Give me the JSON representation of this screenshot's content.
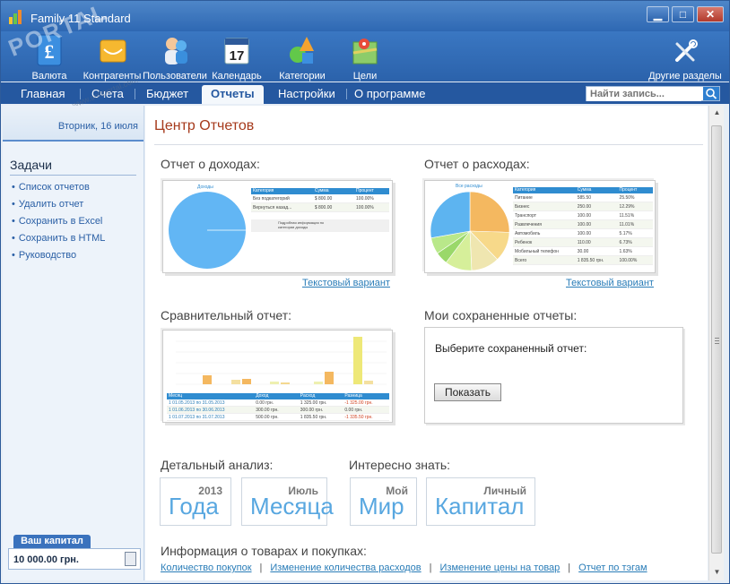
{
  "window": {
    "title": "Family 11 Standard",
    "minimize": "▁",
    "maximize": "□",
    "close": "✕"
  },
  "toolbar": {
    "items": [
      {
        "label": "Валюта",
        "icon": "currency-icon"
      },
      {
        "label": "Контрагенты",
        "icon": "contacts-icon"
      },
      {
        "label": "Пользователи",
        "icon": "users-icon"
      },
      {
        "label": "Календарь",
        "icon": "calendar-icon",
        "badge": "17"
      },
      {
        "label": "Категории",
        "icon": "categories-icon"
      },
      {
        "label": "Цели",
        "icon": "goals-icon"
      },
      {
        "label": "Другие разделы",
        "icon": "tools-icon"
      }
    ]
  },
  "watermark": {
    "text": "PORTAL",
    "url": "www.softportal.com"
  },
  "nav": {
    "tabs": [
      "Главная",
      "Счета",
      "Бюджет",
      "Отчеты",
      "Настройки",
      "О программе"
    ],
    "active": "Отчеты",
    "search_placeholder": "Найти запись..."
  },
  "sidebar": {
    "date": "Вторник, 16 июля",
    "tasks_title": "Задачи",
    "tasks": [
      "Список отчетов",
      "Удалить отчет",
      "Сохранить в Excel",
      "Сохранить в HTML",
      "Руководство"
    ],
    "capital_label": "Ваш капитал",
    "capital_value": "10 000.00 грн."
  },
  "main": {
    "title": "Центр Отчетов",
    "income": {
      "title": "Отчет о доходах:",
      "link": "Текстовый вариант",
      "pie_label": "Доходы",
      "table_headers": [
        "Категория",
        "Сумма",
        "Процент"
      ],
      "rows": [
        [
          "Без подкатегорий",
          "$ 800.00",
          "100.00%"
        ],
        [
          "Вернуться назад...",
          "$ 800.00",
          "100.00%"
        ]
      ],
      "note": "Подробная информация по категории доходы"
    },
    "expense": {
      "title": "Отчет о расходах:",
      "link": "Текстовый вариант",
      "pie_label": "Все расходы",
      "table_headers": [
        "Категория",
        "Сумма",
        "Процент"
      ],
      "rows": [
        [
          "Питание",
          "585.50",
          "25.50%"
        ],
        [
          "Бизнес",
          "250.00",
          "12.29%"
        ],
        [
          "Транспорт",
          "100.00",
          "11.51%"
        ],
        [
          "Развлечения",
          "100.00",
          "11.01%"
        ],
        [
          "Автомобиль",
          "100.00",
          "5.17%"
        ],
        [
          "Ребенок",
          "110.00",
          "6.73%"
        ],
        [
          "Мобильный телефон",
          "30.00",
          "1.63%"
        ],
        [
          "Всего",
          "1 835.50 грн.",
          "100.00%"
        ]
      ],
      "slices": [
        {
          "value": 25.5,
          "color": "#f4b860"
        },
        {
          "value": 12.29,
          "color": "#f7d98a"
        },
        {
          "value": 11.51,
          "color": "#efe6b0"
        },
        {
          "value": 11.01,
          "color": "#d6ef9a"
        },
        {
          "value": 5.17,
          "color": "#9ad86a"
        },
        {
          "value": 6.73,
          "color": "#b9e88a"
        },
        {
          "value": 27.79,
          "color": "#5db4f0"
        }
      ]
    },
    "compare": {
      "title": "Сравнительный отчет:",
      "headers": [
        "Месяц",
        "Доход",
        "Расход",
        "Разница"
      ],
      "rows": [
        [
          "1 01.05.2013 по 31.05.2013",
          "0.00 грн.",
          "1 325.00 грн.",
          "-1 325.00 грн."
        ],
        [
          "1 01.06.2013 по 30.06.2013",
          "300.00 грн.",
          "300.00 грн.",
          "0.00 грн."
        ],
        [
          "1 01.07.2013 по 31.07.2013",
          "500.00 грн.",
          "1 835.50 грн.",
          "-1 335.50 грн."
        ]
      ]
    },
    "saved": {
      "title": "Мои сохраненные отчеты:",
      "prompt": "Выберите сохраненный отчет:",
      "button": "Показать"
    },
    "detail": {
      "title": "Детальный анализ:",
      "tiles": [
        {
          "small": "2013",
          "big": "Года"
        },
        {
          "small": "Июль",
          "big": "Месяца"
        }
      ]
    },
    "interesting": {
      "title": "Интересно знать:",
      "tiles": [
        {
          "small": "Мой",
          "big": "Мир"
        },
        {
          "small": "Личный",
          "big": "Капитал"
        }
      ]
    },
    "goods": {
      "title": "Информация о товарах и покупках:",
      "links": [
        "Количество покупок",
        "Изменение количества расходов",
        "Изменение цены на товар",
        "Отчет по тэгам"
      ]
    }
  }
}
